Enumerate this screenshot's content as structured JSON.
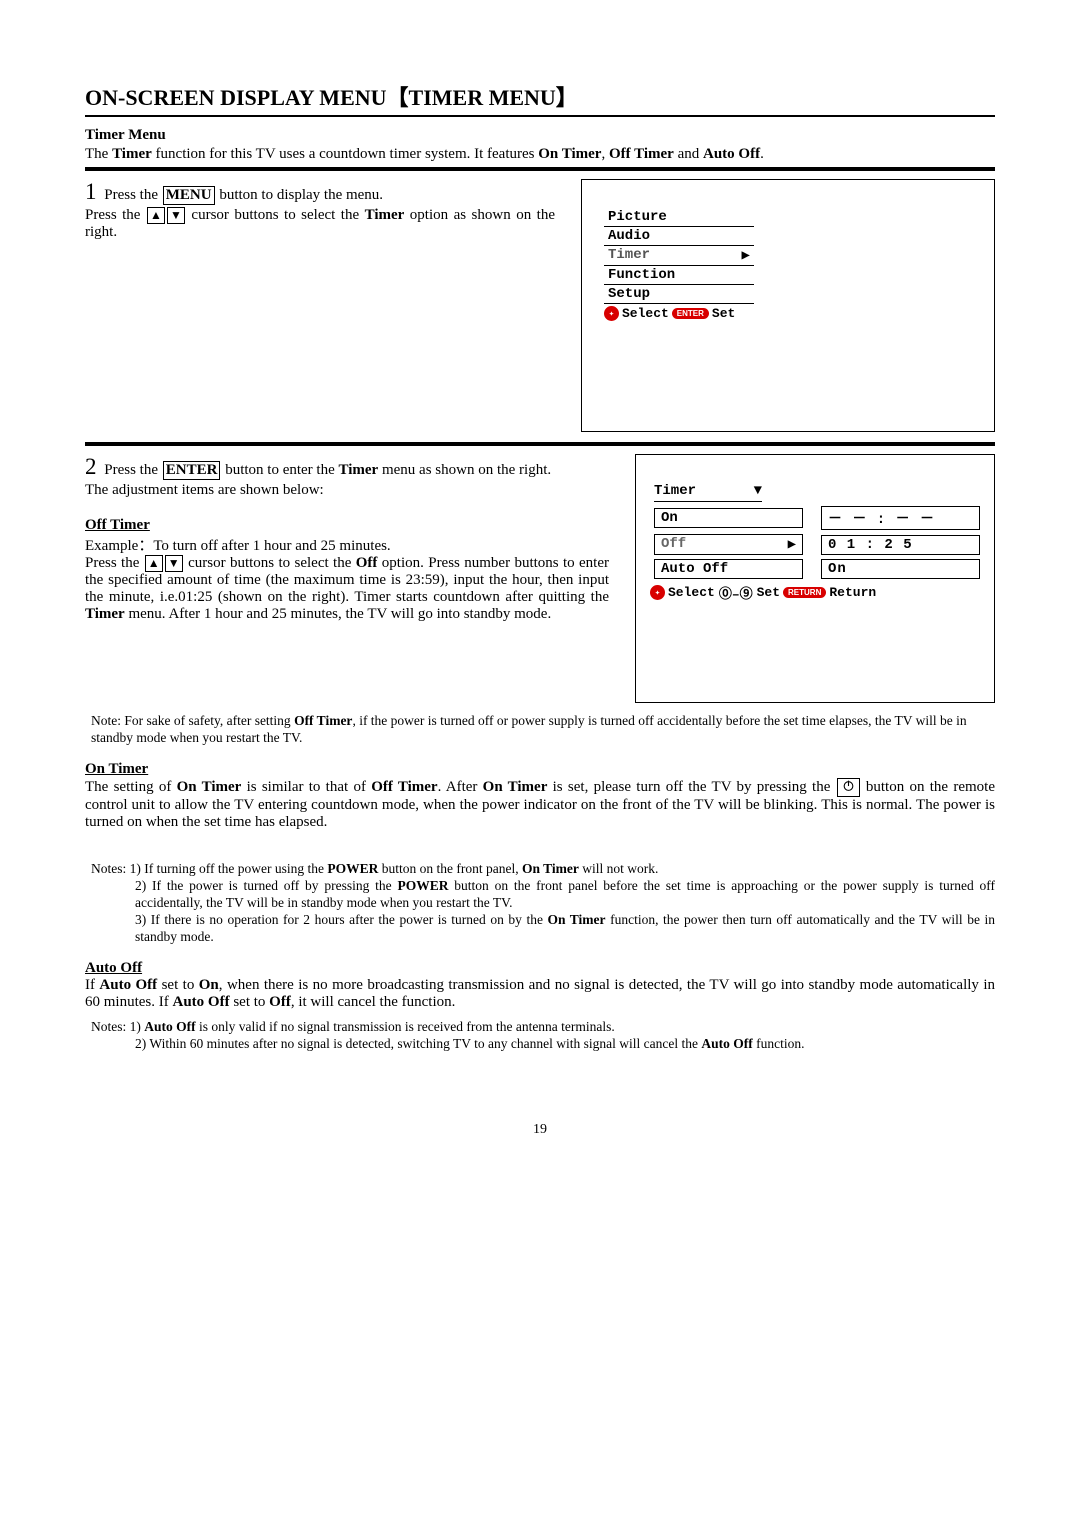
{
  "page_title": "ON-SCREEN DISPLAY MENU【TIMER MENU】",
  "section_title": "Timer Menu",
  "intro_pre": "The ",
  "intro_bold1": "Timer",
  "intro_mid": " function for this TV uses a countdown timer system. It features ",
  "intro_b2": "On Timer",
  "intro_sep1": ", ",
  "intro_b3": "Off Timer",
  "intro_sep2": " and ",
  "intro_b4": "Auto Off",
  "intro_end": ".",
  "step1_line1a": "Press the ",
  "step1_btn_menu": "MENU",
  "step1_line1b": " button to display the menu.",
  "step1_line2a": "Press the ",
  "step1_line2b": " cursor buttons to select the ",
  "step1_line2c": "Timer",
  "step1_line2d": " option as shown on the right.",
  "main_menu": {
    "items": [
      "Picture",
      "Audio",
      "Timer",
      "Function",
      "Setup"
    ],
    "footer_select": "Select",
    "footer_enter_pill": "ENTER",
    "footer_set": "Set"
  },
  "step2_a": "Press the ",
  "step2_btn_enter": "ENTER",
  "step2_b": " button to enter the ",
  "step2_c": "Timer",
  "step2_d": " menu as shown on the right.",
  "step2_line2": "The adjustment items are shown below:",
  "offtimer_head": "Off Timer",
  "offtimer_example": "Example：To turn off after 1 hour and 25 minutes.",
  "off_par_a": "Press the ",
  "off_par_b": " cursor buttons to select the ",
  "off_par_c": "Off",
  "off_par_d": " option. Press number buttons to enter the specified amount of time (the maximum time is 23:59), input the hour, then input the minute, i.e.01:25 (shown on the right). Timer starts countdown after quitting the ",
  "off_par_e": "Timer",
  "off_par_f": " menu. After 1 hour and 25 minutes, the TV will go into standby mode.",
  "timer_menu": {
    "title": "Timer",
    "rows": [
      {
        "label": "On",
        "value": "－ － : － －",
        "selected": false
      },
      {
        "label": "Off",
        "value": "0 1 : 2 5",
        "selected": true
      },
      {
        "label": "Auto Off",
        "value": "On",
        "selected": false
      }
    ],
    "footer_select": "Select",
    "footer_set": "Set",
    "footer_return_pill": "RETURN",
    "footer_return": "Return",
    "footer_digits": "⓪–⑨"
  },
  "note_off_a": "Note: For sake of safety, after setting ",
  "note_off_b": "Off Timer",
  "note_off_c": ", if the power is turned off or power supply is turned off accidentally before the set time elapses, the TV will be in standby mode when you restart the TV.",
  "ontimer_head": "On Timer",
  "on_par_a": "The setting of ",
  "on_par_b": "On Timer",
  "on_par_c": " is similar to that of ",
  "on_par_d": "Off Timer",
  "on_par_e": ". After ",
  "on_par_f": "On Timer",
  "on_par_g": " is set, please turn off the TV by pressing the ",
  "on_par_h": " button on the remote control unit to allow the TV entering countdown mode, when the power indicator on the front of the TV will be blinking. This is normal. The power is turned on when the set time has elapsed.",
  "notes_on_1a": "Notes: 1) If turning off the power using the ",
  "notes_on_1b": "POWER",
  "notes_on_1c": " button on the front panel, ",
  "notes_on_1d": "On Timer",
  "notes_on_1e": " will not work.",
  "notes_on_2a": "2) If the power is turned off by pressing the ",
  "notes_on_2b": "POWER",
  "notes_on_2c": " button on the front panel before the set time is approaching or the power supply is turned off accidentally, the TV will be in standby mode when you restart the TV.",
  "notes_on_3a": "3) If there is no operation for 2 hours after the power is turned on by the ",
  "notes_on_3b": "On Timer",
  "notes_on_3c": " function, the power then turn off automatically and the TV will be in standby mode.",
  "autooff_head": "Auto Off",
  "auto_a": "If ",
  "auto_b": "Auto Off",
  "auto_c": " set to ",
  "auto_d": "On",
  "auto_e": ", when there is no more broadcasting transmission and no signal is detected, the TV will go into standby mode automatically in 60 minutes. If ",
  "auto_f": "Auto Off",
  "auto_g": " set to ",
  "auto_h": "Off",
  "auto_i": ", it will cancel the function.",
  "notes_auto_1a": "Notes: 1) ",
  "notes_auto_1b": "Auto Off",
  "notes_auto_1c": " is only valid if no signal transmission is received from the antenna terminals.",
  "notes_auto_2a": "2) Within 60 minutes after no signal is detected, switching TV to any channel with signal will cancel the ",
  "notes_auto_2b": "Auto Off",
  "notes_auto_2c": " function.",
  "page_number": "19"
}
